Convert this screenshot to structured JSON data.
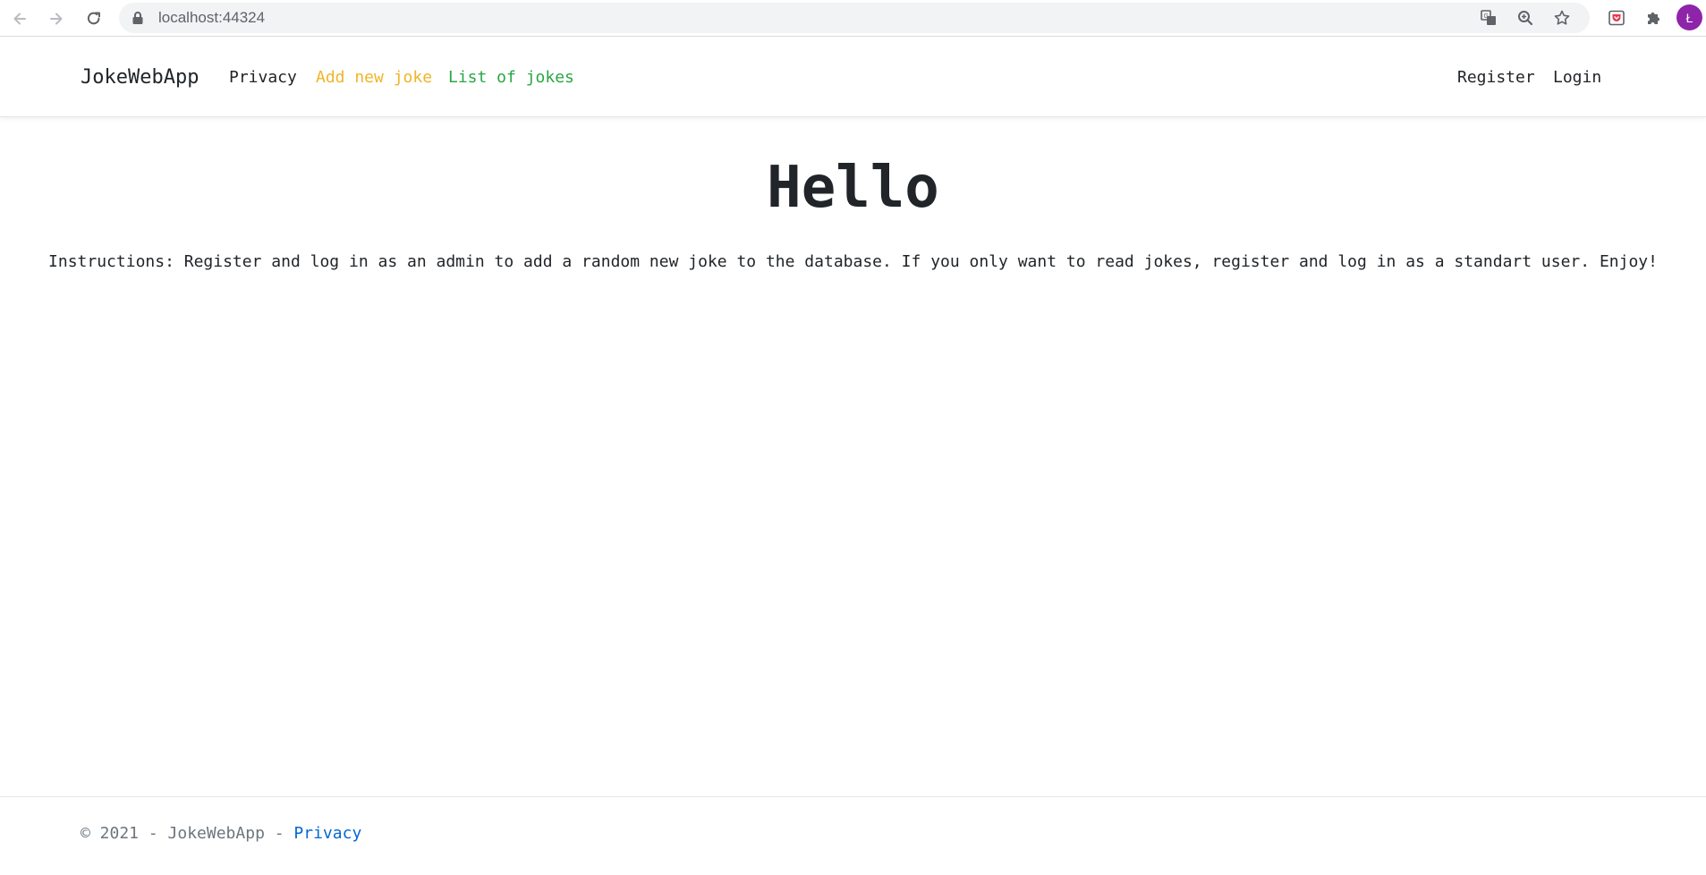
{
  "browser": {
    "url": "localhost:44324",
    "profile_initial": "Ł",
    "icons": {
      "back": "back-arrow-icon",
      "forward": "forward-arrow-icon",
      "reload": "reload-icon",
      "lock": "lock-icon",
      "translate": "translate-icon",
      "zoom": "zoom-icon",
      "bookmark": "star-icon",
      "extension_pocket": "pocket-icon",
      "extensions": "puzzle-icon"
    }
  },
  "navbar": {
    "brand": "JokeWebApp",
    "links": [
      {
        "label": "Privacy",
        "color": "#212529"
      },
      {
        "label": "Add new joke",
        "color": "#f0b429"
      },
      {
        "label": "List of jokes",
        "color": "#28a745"
      }
    ],
    "right_links": [
      {
        "label": "Register"
      },
      {
        "label": "Login"
      }
    ]
  },
  "main": {
    "heading": "Hello",
    "instructions": "Instructions: Register and log in as an admin to add a random new joke to the database. If you only want to read jokes, register and log in as a standart user. Enjoy!"
  },
  "footer": {
    "copyright": "© 2021 - JokeWebApp - ",
    "privacy_link": "Privacy",
    "link_color": "#0366d6"
  }
}
